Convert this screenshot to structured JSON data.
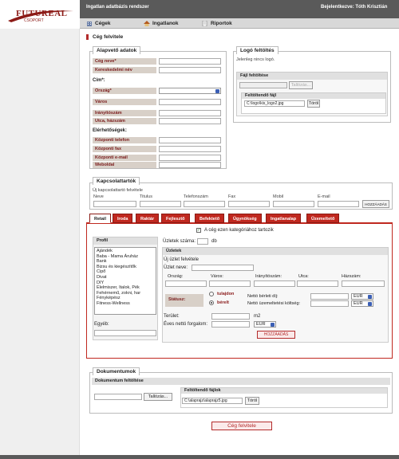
{
  "header": {
    "logo_text": "FUTUREAL",
    "logo_sub": "CSOPORT",
    "app_title": "Ingatlan adatbázis rendszer",
    "user_info": "Bejelentkezve: Tóth Krisztián"
  },
  "nav": {
    "items": [
      {
        "label": "Cégek",
        "icon": "building-icon"
      },
      {
        "label": "Ingatlanok",
        "icon": "house-icon"
      },
      {
        "label": "Riportok",
        "icon": "report-icon"
      }
    ]
  },
  "page": {
    "title": "Cég felvitele"
  },
  "basic": {
    "legend": "Alapvető adatok",
    "fields": [
      "Cég neve*",
      "Kereskedelmi név"
    ],
    "address_heading": "Cím*:",
    "address_fields": [
      "Ország*",
      "Város",
      "Irányítószám",
      "Utca, házszám"
    ],
    "contact_heading": "Elérhetőségek:",
    "contact_fields": [
      "Központi telefon",
      "Központi fax",
      "Központi e-mail",
      "Weboldal"
    ]
  },
  "logo": {
    "legend": "Logó feltöltés",
    "status": "Jelenleg nincs logó.",
    "upload_header": "Fájl feltöltése",
    "browse_label": "Tallózás...",
    "uploaded_header": "Feltöltendő fájl",
    "file_name": "C:\\logo\\kis_logo2.jpg",
    "delete_label": "Töröl"
  },
  "contacts": {
    "legend": "Kapcsolattartók",
    "add_heading": "Új kapcsolattartó felvétele",
    "columns": [
      "Neve",
      "Titulus",
      "Telefonszám",
      "Fax",
      "Mobil",
      "E-mail"
    ],
    "add_button": "HOZZÁADÁS"
  },
  "tabs": [
    "Retail",
    "Iroda",
    "Raktár",
    "Fejlesztő",
    "Befektető",
    "Ügynökség",
    "Ingatlanalap",
    "Üzemeltető"
  ],
  "retail": {
    "checkbox_label": "A cég ezen kategóriához tartozik",
    "profil_header": "Profil",
    "profil_options": [
      "Ajándék",
      "Baba - Mama Áruház",
      "Bank",
      "Bizsu és kiegészítők",
      "Cipő",
      "Divat",
      "DIY",
      "Élelmiszer, Italok, Pék",
      "Fehérnemű, zokni, har",
      "Fényképész",
      "Fitness-Wellness"
    ],
    "egyeb_label": "Egyéb:",
    "stores_label": "Üzletek száma:",
    "stores_unit": "db",
    "uzletek_header": "Üzletek",
    "new_store": "Új üzlet felvétele",
    "store_name_label": "Üzlet neve:",
    "address_cols": [
      "Ország:",
      "Város:",
      "Irányítószám:",
      "Utca:",
      "Házszám:"
    ],
    "statusz_label": "Státusz:",
    "radio_owned": "tulajdon",
    "radio_rented": "bérelt",
    "net_rent_label": "Nettó bérleti díj:",
    "net_op_label": "Nettó üzemeltetési költség:",
    "currency": "EUR",
    "area_label": "Terület:",
    "area_unit": "m2",
    "turnover_label": "Éves nettó forgalom:",
    "add_button": "HOZZÁADÁS"
  },
  "documents": {
    "legend": "Dokumentumok",
    "upload_header": "Dokumentum feltöltése",
    "browse_label": "Tallózás...",
    "uploaded_header": "Feltöltendő fájlok",
    "file_name": "C:\\alaprajz\\alaprajz5.jpg",
    "delete_label": "Töröl"
  },
  "submit_label": "Cég felvitele",
  "colors": {
    "accent": "#c0281f",
    "topbar": "#5a5a5a",
    "label_bg": "#d8d0c8"
  }
}
